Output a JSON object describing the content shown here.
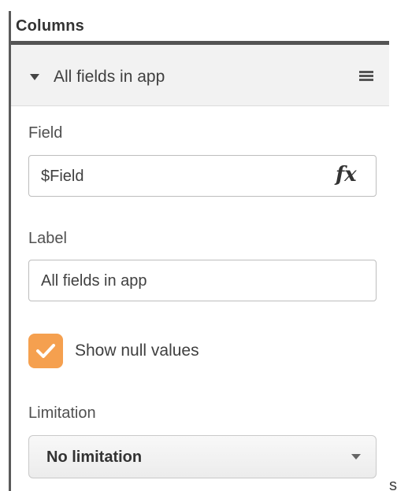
{
  "panel": {
    "section_title": "Columns",
    "item": {
      "label": "All fields in app",
      "expand_icon": "caret-down-icon",
      "menu_icon": "hamburger-menu-icon"
    },
    "field": {
      "label": "Field",
      "value": "$Field",
      "expression_icon": "fx-icon",
      "expression_glyph": "fx"
    },
    "label_field": {
      "label": "Label",
      "value": "All fields in app"
    },
    "show_null_values": {
      "label": "Show null values",
      "checked": true,
      "color": "#f5a04f"
    },
    "limitation": {
      "label": "Limitation",
      "selected": "No limitation"
    },
    "stray_text": "s"
  }
}
